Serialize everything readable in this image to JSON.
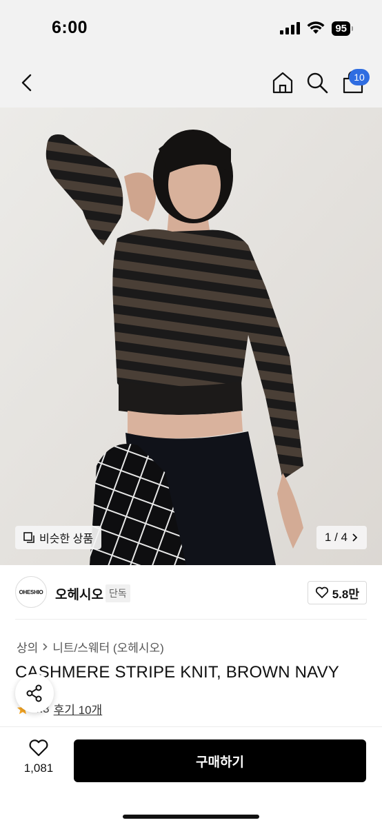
{
  "status_bar": {
    "time": "6:00",
    "battery": "95",
    "icons": [
      "signal-icon",
      "wifi-icon",
      "battery-icon"
    ]
  },
  "nav": {
    "back_icon": "chevron-left-icon",
    "home_icon": "home-icon",
    "search_icon": "search-icon",
    "cart_icon": "shopping-bag-icon",
    "cart_badge": "10"
  },
  "product_image": {
    "similar_label": "비슷한 상품",
    "page_indicator": "1 / 4"
  },
  "brand": {
    "logo_text": "OHESHIO",
    "name": "오헤시오",
    "tag": "단독",
    "likes": "5.8만"
  },
  "breadcrumb": {
    "items": [
      "상의",
      "니트/스웨터 (오헤시오)"
    ]
  },
  "product": {
    "title": "CASHMERE STRIPE KNIT, BROWN NAVY",
    "rating": "4.3",
    "review_label": "후기 10개"
  },
  "bottom_bar": {
    "wish_count": "1,081",
    "buy_label": "구매하기"
  },
  "colors": {
    "accent_badge": "#2f6de1",
    "buy_button": "#000000",
    "star": "#f5a623"
  }
}
